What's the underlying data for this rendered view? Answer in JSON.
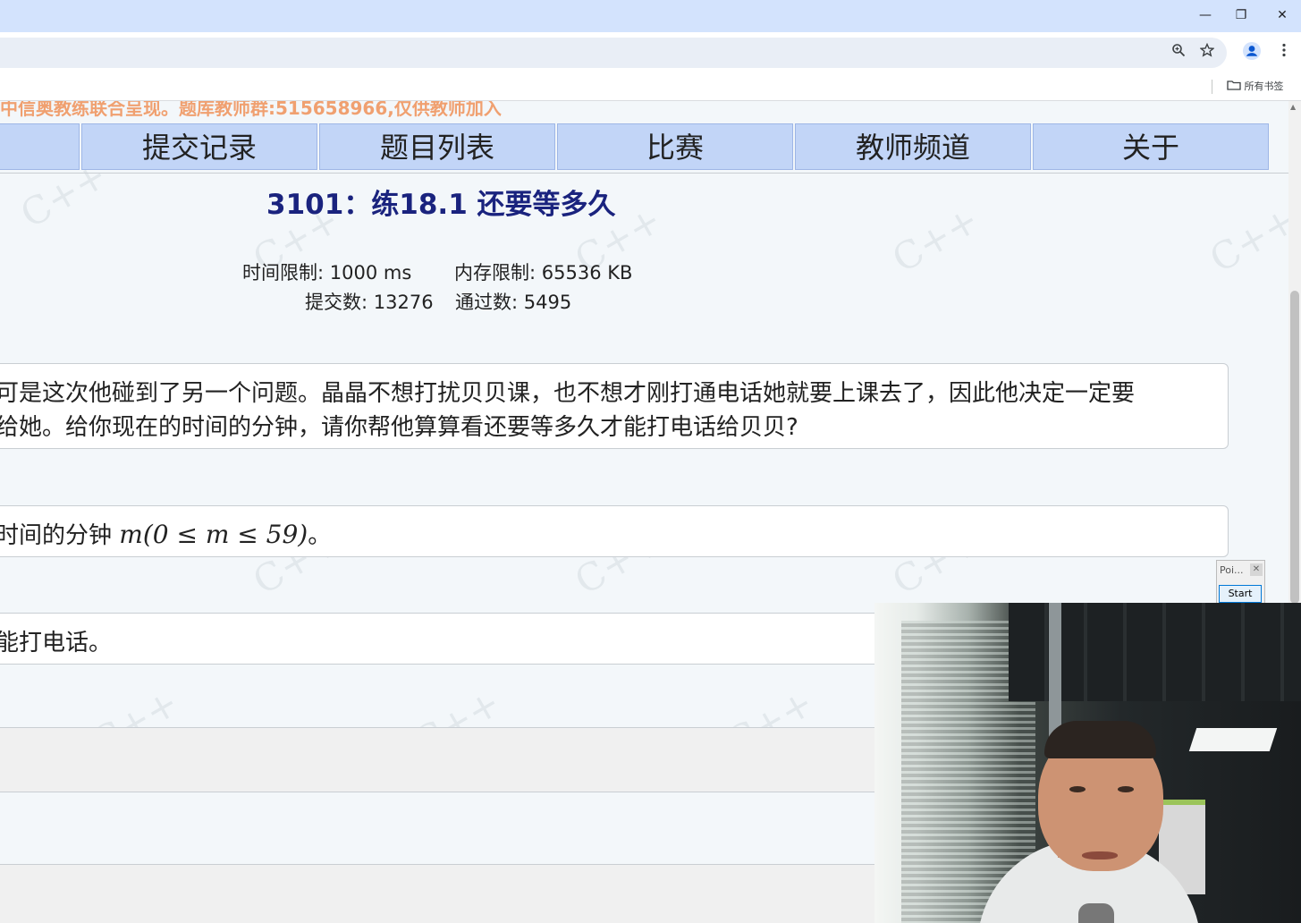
{
  "browser": {
    "window_controls": {
      "minimize": "—",
      "restore": "❐",
      "close": "✕"
    },
    "toolbar_icons": [
      "zoom-icon",
      "star-icon",
      "profile-icon",
      "menu-icon"
    ],
    "bookmarks_all_label": "所有书签"
  },
  "page": {
    "notice": "中信奥教练联合呈现。题库教师群:515658966,仅供教师加入",
    "nav": [
      "提交记录",
      "题目列表",
      "比赛",
      "教师频道",
      "关于"
    ],
    "problem": {
      "title": "3101：练18.1 还要等多久",
      "time_limit": "时间限制: 1000 ms",
      "memory_limit": "内存限制: 65536 KB",
      "submissions": "提交数: 13276",
      "accepted": "通过数: 5495"
    },
    "description": {
      "line1": "可是这次他碰到了另一个问题。晶晶不想打扰贝贝课，也不想才刚打通电话她就要上课去了，因此他决定一定要",
      "line2": "给她。给你现在的时间的分钟，请你帮他算算看还要等多久才能打电话给贝贝?"
    },
    "input_desc": {
      "prefix": "时间的分钟 ",
      "math": "m(0 ≤ m ≤ 59)",
      "suffix": "。"
    },
    "output_desc": "能打电话。"
  },
  "popup": {
    "title": "Poi...",
    "close": "✕",
    "start_label": "Start"
  },
  "colors": {
    "nav_bg": "#c2d5f7",
    "title": "#1a237e",
    "notice": "#f0a070"
  }
}
